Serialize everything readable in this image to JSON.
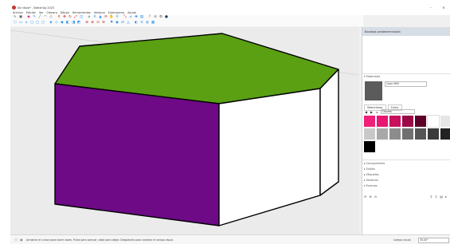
{
  "window": {
    "title": "Sin título* - SketchUp 2023",
    "minimize": "–",
    "maximize": "□",
    "close": "✕"
  },
  "menu": [
    "Archivo",
    "Edición",
    "Ver",
    "Cámara",
    "Dibujo",
    "Herramientas",
    "Ventana",
    "Extensiones",
    "Ayuda"
  ],
  "toolbar1": [
    {
      "name": "select-icon",
      "glyph": "↖",
      "color": "#333333"
    },
    {
      "name": "component-icon",
      "glyph": "▣",
      "color": "#555555"
    },
    {
      "name": "eraser-icon",
      "glyph": "◆",
      "color": "#d63384"
    },
    {
      "name": "pencil-icon",
      "glyph": "✎",
      "color": "#1e88e5"
    },
    {
      "name": "line-icon",
      "glyph": "╱",
      "color": "#2e7d32"
    },
    {
      "name": "arc-icon",
      "glyph": "◠",
      "color": "#555555"
    },
    {
      "name": "shape-icon",
      "glyph": "◇",
      "color": "#555555"
    },
    {
      "name": "push-pull-icon",
      "glyph": "⬆",
      "color": "#e65100"
    },
    {
      "name": "move-icon",
      "glyph": "✥",
      "color": "#c62828"
    },
    {
      "name": "rotate-icon",
      "glyph": "↻",
      "color": "#c62828"
    },
    {
      "name": "scale-icon",
      "glyph": "⤢",
      "color": "#c62828"
    },
    {
      "name": "offset-icon",
      "glyph": "◫",
      "color": "#1e88e5"
    },
    {
      "name": "tape-icon",
      "glyph": "⌀",
      "color": "#555555"
    },
    {
      "name": "text-icon",
      "glyph": "A",
      "color": "#1e88e5"
    },
    {
      "name": "paint-icon",
      "glyph": "▲",
      "color": "#1e88e5"
    },
    {
      "name": "orbit-icon",
      "glyph": "⟳",
      "color": "#c62828"
    },
    {
      "name": "pan-icon",
      "glyph": "✋",
      "color": "#1e88e5"
    },
    {
      "name": "zoom-icon",
      "glyph": "⚲",
      "color": "#1e88e5"
    },
    {
      "name": "zoom-extents-icon",
      "glyph": "⤡",
      "color": "#c62828"
    },
    {
      "name": "warehouse-icon",
      "glyph": "⌂",
      "color": "#1e88e5"
    },
    {
      "name": "extension-icon",
      "glyph": "✚",
      "color": "#1e88e5"
    },
    {
      "name": "layout-icon",
      "glyph": "▤",
      "color": "#1e88e5"
    },
    {
      "name": "help-icon",
      "glyph": "?",
      "color": "#555555"
    },
    {
      "name": "clip-icon",
      "glyph": "⊘",
      "color": "#555555"
    },
    {
      "name": "settings-icon",
      "glyph": "⚙",
      "color": "#555555"
    },
    {
      "name": "user-icon",
      "glyph": "●",
      "color": "#1a3a6b"
    }
  ],
  "toolbar2": [
    {
      "name": "iso-view-icon",
      "glyph": "⬡",
      "color": "#1e88e5"
    },
    {
      "name": "top-view-icon",
      "glyph": "▭",
      "color": "#1e88e5"
    },
    {
      "name": "front-view-icon",
      "glyph": "⌂",
      "color": "#1e88e5"
    },
    {
      "name": "right-view-icon",
      "glyph": "▢",
      "color": "#1e88e5"
    },
    {
      "name": "back-view-icon",
      "glyph": "▢",
      "color": "#1e88e5"
    },
    {
      "name": "left-view-icon",
      "glyph": "▢",
      "color": "#1e88e5"
    },
    {
      "name": "xray-icon",
      "glyph": "◈",
      "color": "#1e88e5"
    },
    {
      "name": "wireframe-icon",
      "glyph": "◇",
      "color": "#1e88e5"
    },
    {
      "name": "hidden-line-icon",
      "glyph": "◆",
      "color": "#1e88e5"
    },
    {
      "name": "shaded-icon",
      "glyph": "◧",
      "color": "#1e88e5"
    },
    {
      "name": "textured-icon",
      "glyph": "◨",
      "color": "#1e88e5"
    },
    {
      "name": "monochrome-icon",
      "glyph": "◩",
      "color": "#1e88e5"
    },
    {
      "name": "section-plane-icon",
      "glyph": "⊕",
      "color": "#c62828"
    },
    {
      "name": "section-cut-icon",
      "glyph": "⊗",
      "color": "#c62828"
    },
    {
      "name": "section-fill-icon",
      "glyph": "⊙",
      "color": "#c62828"
    },
    {
      "name": "axes-icon",
      "glyph": "✣",
      "color": "#c62828"
    },
    {
      "name": "walk-icon",
      "glyph": "⚑",
      "color": "#1e88e5"
    },
    {
      "name": "look-around-icon",
      "glyph": "◉",
      "color": "#1e88e5"
    },
    {
      "name": "position-camera-icon",
      "glyph": "⊡",
      "color": "#1e88e5"
    },
    {
      "name": "sandbox-icon",
      "glyph": "◬",
      "color": "#1e88e5"
    },
    {
      "name": "shadows-icon",
      "glyph": "◐",
      "color": "#1e88e5"
    },
    {
      "name": "fog-icon",
      "glyph": "≋",
      "color": "#1e88e5"
    },
    {
      "name": "styles-icon",
      "glyph": "◍",
      "color": "#1e88e5"
    },
    {
      "name": "scenes-icon",
      "glyph": "▦",
      "color": "#1e88e5"
    }
  ],
  "scene": {
    "top_face_color": "#5aa012",
    "left_face_color": "#6e0a86",
    "right_face_color": "#ffffff",
    "edge_color": "#000000",
    "background_color": "#ebebeb"
  },
  "tray": {
    "title": "Bandeja predeterminada",
    "materials_header": "Materiales",
    "material_name": "Color M00",
    "tabs": [
      "Seleccionar",
      "Editar"
    ],
    "home_label": "Colores",
    "swatches": [
      "#ef1f7a",
      "#e81670",
      "#c8105e",
      "#9b0a47",
      "#5c0028",
      "#ffffff",
      "#e6e6e6",
      "#c8c8c8",
      "#a8a8a8",
      "#8c8c8c",
      "#707070",
      "#555555",
      "#3a3a3a",
      "#222222",
      "#000000"
    ],
    "sections": [
      "Componentes",
      "Estilos",
      "Etiquetas",
      "Sombras",
      "Escenas"
    ]
  },
  "status": {
    "text": "Arrastrar el cursor para hacer zoom. Pulse para acercar; aleje para alejar. Desplácelo para cambiar el campo visual.",
    "measure_label": "Campo visual",
    "measure_value": "35,00°"
  }
}
